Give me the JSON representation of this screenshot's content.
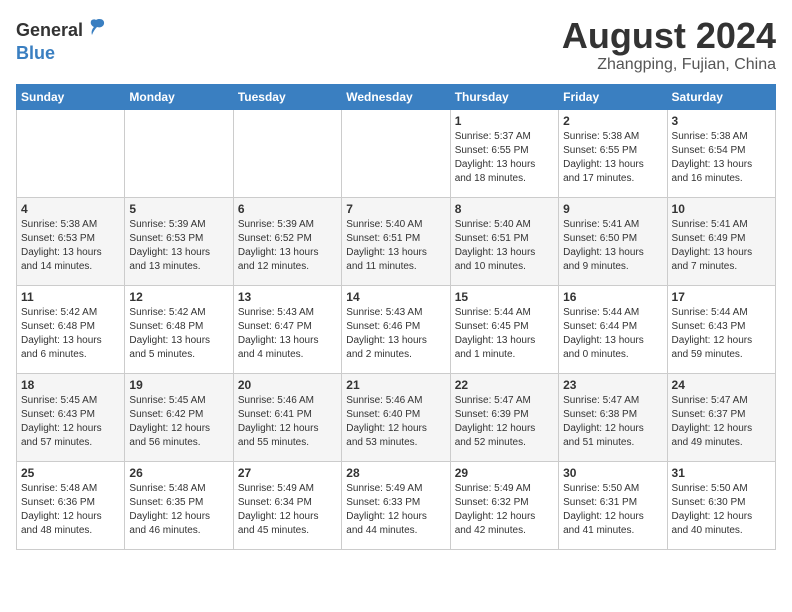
{
  "header": {
    "logo_general": "General",
    "logo_blue": "Blue",
    "month_year": "August 2024",
    "location": "Zhangping, Fujian, China"
  },
  "weekdays": [
    "Sunday",
    "Monday",
    "Tuesday",
    "Wednesday",
    "Thursday",
    "Friday",
    "Saturday"
  ],
  "weeks": [
    [
      {
        "day": "",
        "info": ""
      },
      {
        "day": "",
        "info": ""
      },
      {
        "day": "",
        "info": ""
      },
      {
        "day": "",
        "info": ""
      },
      {
        "day": "1",
        "info": "Sunrise: 5:37 AM\nSunset: 6:55 PM\nDaylight: 13 hours\nand 18 minutes."
      },
      {
        "day": "2",
        "info": "Sunrise: 5:38 AM\nSunset: 6:55 PM\nDaylight: 13 hours\nand 17 minutes."
      },
      {
        "day": "3",
        "info": "Sunrise: 5:38 AM\nSunset: 6:54 PM\nDaylight: 13 hours\nand 16 minutes."
      }
    ],
    [
      {
        "day": "4",
        "info": "Sunrise: 5:38 AM\nSunset: 6:53 PM\nDaylight: 13 hours\nand 14 minutes."
      },
      {
        "day": "5",
        "info": "Sunrise: 5:39 AM\nSunset: 6:53 PM\nDaylight: 13 hours\nand 13 minutes."
      },
      {
        "day": "6",
        "info": "Sunrise: 5:39 AM\nSunset: 6:52 PM\nDaylight: 13 hours\nand 12 minutes."
      },
      {
        "day": "7",
        "info": "Sunrise: 5:40 AM\nSunset: 6:51 PM\nDaylight: 13 hours\nand 11 minutes."
      },
      {
        "day": "8",
        "info": "Sunrise: 5:40 AM\nSunset: 6:51 PM\nDaylight: 13 hours\nand 10 minutes."
      },
      {
        "day": "9",
        "info": "Sunrise: 5:41 AM\nSunset: 6:50 PM\nDaylight: 13 hours\nand 9 minutes."
      },
      {
        "day": "10",
        "info": "Sunrise: 5:41 AM\nSunset: 6:49 PM\nDaylight: 13 hours\nand 7 minutes."
      }
    ],
    [
      {
        "day": "11",
        "info": "Sunrise: 5:42 AM\nSunset: 6:48 PM\nDaylight: 13 hours\nand 6 minutes."
      },
      {
        "day": "12",
        "info": "Sunrise: 5:42 AM\nSunset: 6:48 PM\nDaylight: 13 hours\nand 5 minutes."
      },
      {
        "day": "13",
        "info": "Sunrise: 5:43 AM\nSunset: 6:47 PM\nDaylight: 13 hours\nand 4 minutes."
      },
      {
        "day": "14",
        "info": "Sunrise: 5:43 AM\nSunset: 6:46 PM\nDaylight: 13 hours\nand 2 minutes."
      },
      {
        "day": "15",
        "info": "Sunrise: 5:44 AM\nSunset: 6:45 PM\nDaylight: 13 hours\nand 1 minute."
      },
      {
        "day": "16",
        "info": "Sunrise: 5:44 AM\nSunset: 6:44 PM\nDaylight: 13 hours\nand 0 minutes."
      },
      {
        "day": "17",
        "info": "Sunrise: 5:44 AM\nSunset: 6:43 PM\nDaylight: 12 hours\nand 59 minutes."
      }
    ],
    [
      {
        "day": "18",
        "info": "Sunrise: 5:45 AM\nSunset: 6:43 PM\nDaylight: 12 hours\nand 57 minutes."
      },
      {
        "day": "19",
        "info": "Sunrise: 5:45 AM\nSunset: 6:42 PM\nDaylight: 12 hours\nand 56 minutes."
      },
      {
        "day": "20",
        "info": "Sunrise: 5:46 AM\nSunset: 6:41 PM\nDaylight: 12 hours\nand 55 minutes."
      },
      {
        "day": "21",
        "info": "Sunrise: 5:46 AM\nSunset: 6:40 PM\nDaylight: 12 hours\nand 53 minutes."
      },
      {
        "day": "22",
        "info": "Sunrise: 5:47 AM\nSunset: 6:39 PM\nDaylight: 12 hours\nand 52 minutes."
      },
      {
        "day": "23",
        "info": "Sunrise: 5:47 AM\nSunset: 6:38 PM\nDaylight: 12 hours\nand 51 minutes."
      },
      {
        "day": "24",
        "info": "Sunrise: 5:47 AM\nSunset: 6:37 PM\nDaylight: 12 hours\nand 49 minutes."
      }
    ],
    [
      {
        "day": "25",
        "info": "Sunrise: 5:48 AM\nSunset: 6:36 PM\nDaylight: 12 hours\nand 48 minutes."
      },
      {
        "day": "26",
        "info": "Sunrise: 5:48 AM\nSunset: 6:35 PM\nDaylight: 12 hours\nand 46 minutes."
      },
      {
        "day": "27",
        "info": "Sunrise: 5:49 AM\nSunset: 6:34 PM\nDaylight: 12 hours\nand 45 minutes."
      },
      {
        "day": "28",
        "info": "Sunrise: 5:49 AM\nSunset: 6:33 PM\nDaylight: 12 hours\nand 44 minutes."
      },
      {
        "day": "29",
        "info": "Sunrise: 5:49 AM\nSunset: 6:32 PM\nDaylight: 12 hours\nand 42 minutes."
      },
      {
        "day": "30",
        "info": "Sunrise: 5:50 AM\nSunset: 6:31 PM\nDaylight: 12 hours\nand 41 minutes."
      },
      {
        "day": "31",
        "info": "Sunrise: 5:50 AM\nSunset: 6:30 PM\nDaylight: 12 hours\nand 40 minutes."
      }
    ]
  ]
}
